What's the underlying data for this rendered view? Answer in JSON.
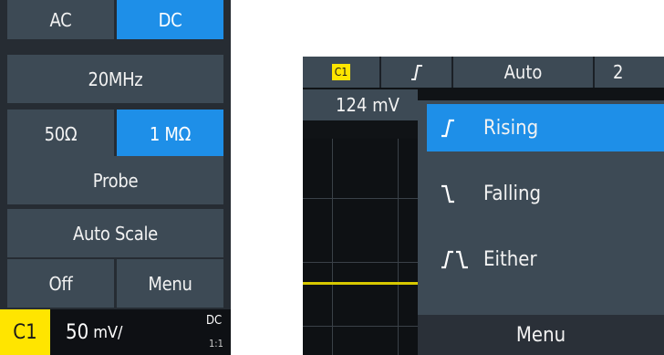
{
  "left_panel": {
    "coupling": {
      "ac_label": "AC",
      "dc_label": "DC",
      "selected": "DC"
    },
    "bandwidth_label": "20MHz",
    "impedance": {
      "low_label": "50Ω",
      "high_label": "1 MΩ",
      "selected": "1 MΩ"
    },
    "probe_label": "Probe",
    "auto_scale_label": "Auto Scale",
    "off_label": "Off",
    "menu_label": "Menu",
    "channel_bar": {
      "channel": "C1",
      "scale_value": "50",
      "scale_unit": "mV/",
      "coupling": "DC",
      "ratio": "1:1"
    }
  },
  "right_panel": {
    "trigger_bar": {
      "source": "C1",
      "slope_icon": "rising-edge-icon",
      "mode": "Auto",
      "partial_value": "2"
    },
    "level_value": "124 mV",
    "slope_menu": {
      "items": [
        {
          "label": "Rising",
          "icon": "rising-edge-icon",
          "selected": true
        },
        {
          "label": "Falling",
          "icon": "falling-edge-icon",
          "selected": false
        },
        {
          "label": "Either",
          "icon": "either-edge-icon",
          "selected": false
        }
      ],
      "footer_label": "Menu"
    },
    "colors": {
      "accent": "#1e8fe8",
      "channel_yellow": "#ffe500",
      "button_bg": "#3d4a55",
      "trace": "#d8c800"
    }
  }
}
